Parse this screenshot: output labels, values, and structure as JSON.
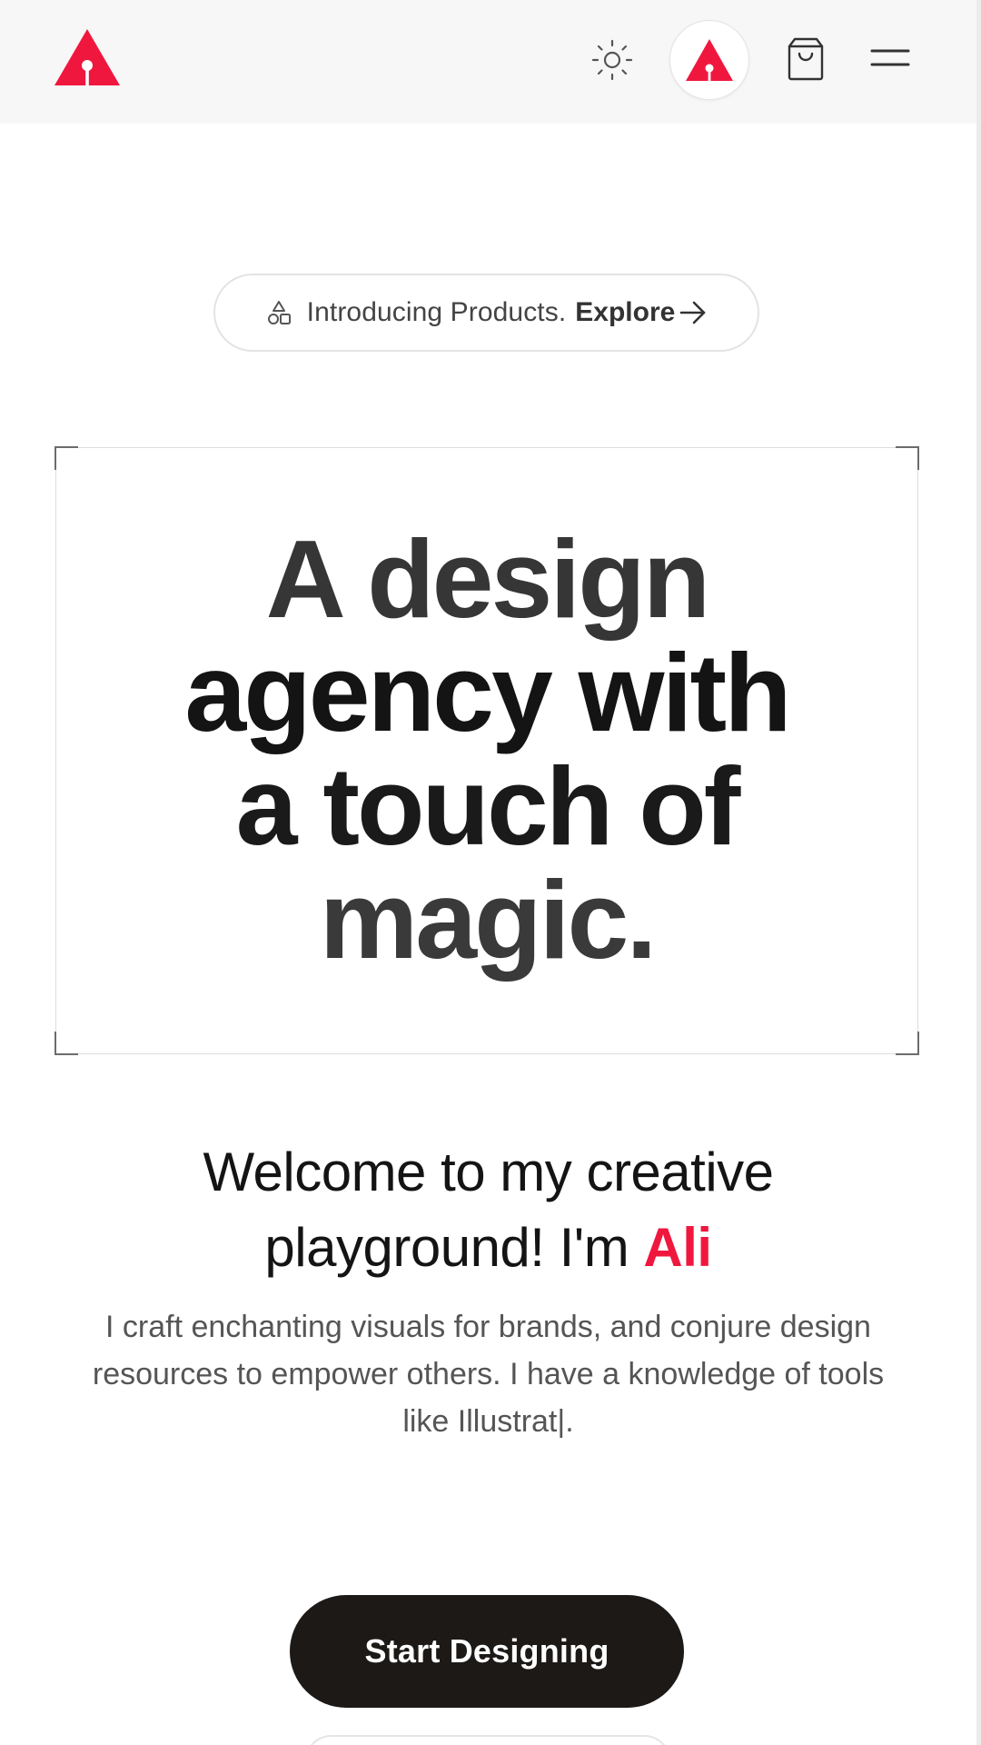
{
  "header": {
    "logo_alt": "brand logo",
    "theme_toggle_icon": "sun-icon",
    "avatar_icon": "triangle-logo-icon",
    "cart_icon": "shopping-bag-icon",
    "menu_icon": "hamburger-menu-icon",
    "brand_color": "#f0173f"
  },
  "announcement": {
    "icon": "shapes-icon",
    "text": "Introducing Products.",
    "link_label": "Explore",
    "link_icon": "arrow-right-icon"
  },
  "hero": {
    "title_lines": [
      "A design",
      "agency with",
      "a touch of",
      "magic."
    ]
  },
  "welcome": {
    "line1": "Welcome to my creative",
    "line2_prefix": "playground! I'm ",
    "name": "Ali"
  },
  "intro": {
    "text": "I craft enchanting visuals for brands, and conjure design resources to empower others. I have a knowledge of tools like Illustrat",
    "cursor": "|."
  },
  "cta": {
    "primary_label": "Start Designing"
  },
  "colors": {
    "accent": "#f0173f",
    "button_dark": "#1c1917",
    "header_bg": "#f7f7f7",
    "body_text": "#555555"
  }
}
